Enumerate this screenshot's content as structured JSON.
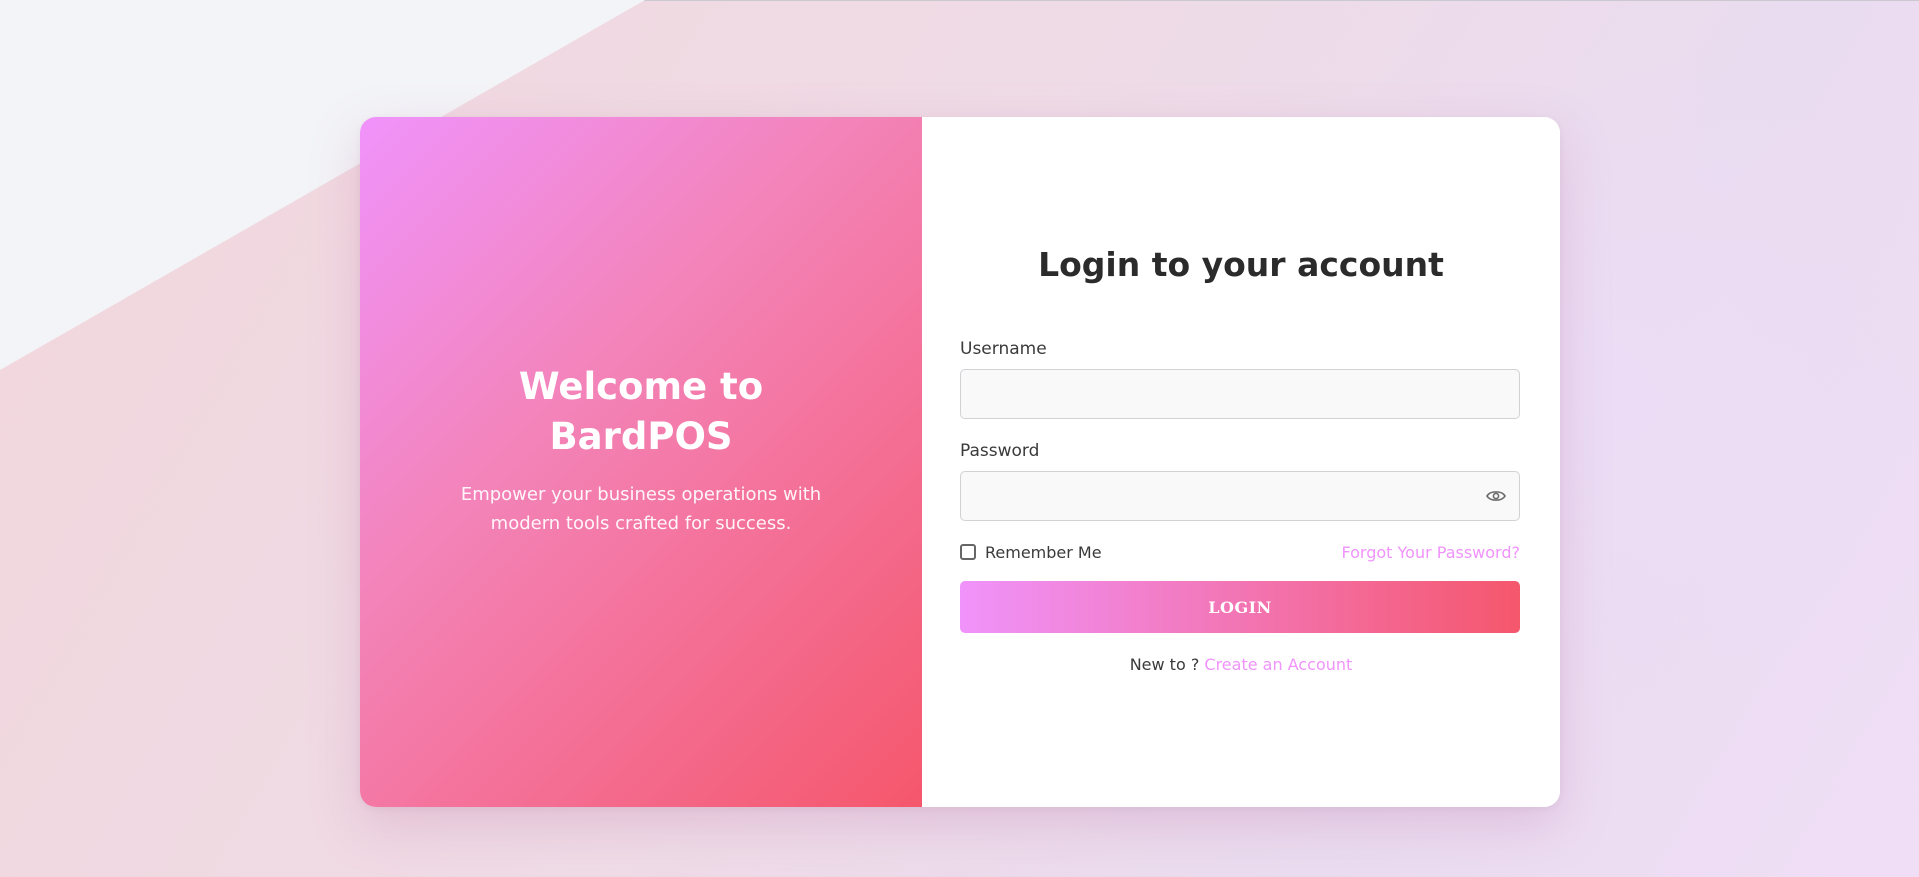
{
  "brand": {
    "welcome_title": "Welcome to BardPOS",
    "welcome_subtitle": "Empower your business operations with modern tools crafted for success."
  },
  "login": {
    "heading": "Login to your account",
    "username_label": "Username",
    "username_value": "",
    "password_label": "Password",
    "password_value": "",
    "password_toggle_icon": "eye-icon",
    "remember_label": "Remember Me",
    "remember_checked": false,
    "forgot_link": "Forgot Your Password?",
    "submit_label": "LOGIN",
    "signup_prompt": "New to ?",
    "signup_link": "Create an Account"
  },
  "colors": {
    "gradient_start": "#f093fb",
    "gradient_end": "#f5576c",
    "link": "#f093fb"
  }
}
